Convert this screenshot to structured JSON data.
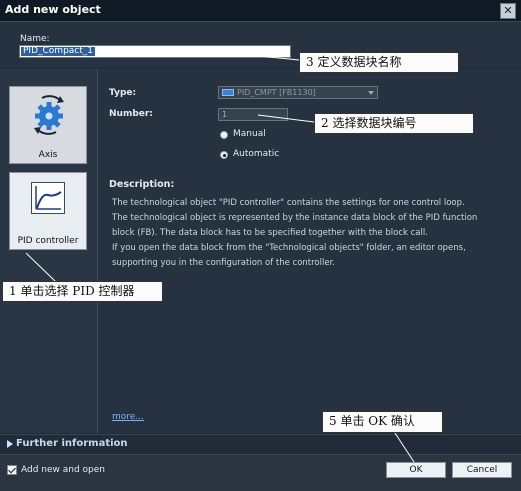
{
  "dialog": {
    "title": "Add new object",
    "close_label": "✕"
  },
  "name": {
    "label": "Name:",
    "value": "PID_Compact_1"
  },
  "tiles": [
    {
      "label": "Axis",
      "icon": "axis-gear-icon"
    },
    {
      "label": "PID controller",
      "icon": "pid-chart-icon"
    }
  ],
  "type": {
    "label": "Type:",
    "value": "PID_CMPT [FB1130]"
  },
  "number": {
    "label": "Number:",
    "value": "1"
  },
  "radios": [
    {
      "label": "Manual",
      "selected": false
    },
    {
      "label": "Automatic",
      "selected": true
    }
  ],
  "description": {
    "heading": "Description:",
    "lines": [
      "The technological object \"PID controller\" contains the settings for one control loop.",
      "The technological object is represented by the instance data block of the PID function block (FB). The data block has to be specified together with the block call.",
      "If you open the data block from the \"Technological objects\" folder, an editor opens, supporting you in the configuration of the controller."
    ]
  },
  "more_link": "more...",
  "further_info": "Further information",
  "footer": {
    "checkbox_label": "Add new and open",
    "checkbox_checked": true,
    "ok_label": "OK",
    "cancel_label": "Cancel"
  },
  "annotations": {
    "name": "3 定义数据块名称",
    "number": "2 选择数据块编号",
    "pid": "1 单击选择 PID 控制器",
    "ok": "5 单击 OK 确认"
  },
  "colors": {
    "dialog_bg": "#26323f",
    "title_bar": "#101a24",
    "selection": "#2d5f9a",
    "link": "#7fb0ff"
  }
}
